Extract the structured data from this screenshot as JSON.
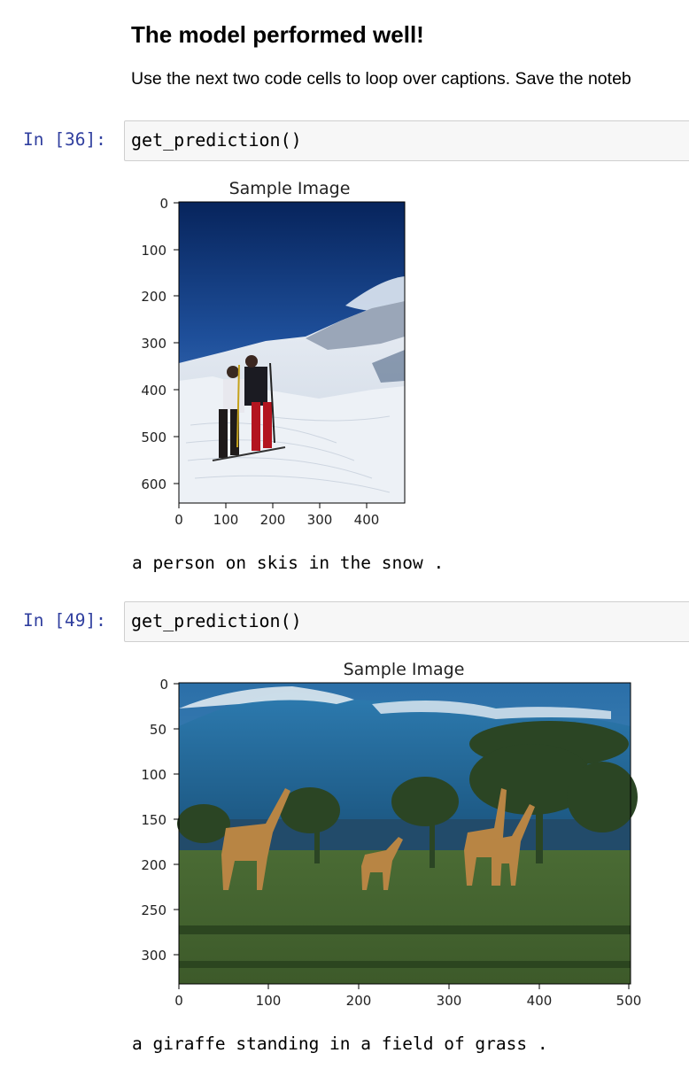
{
  "markdown": {
    "heading": "The model performed well!",
    "text": "Use the next two code cells to loop over captions. Save the noteb"
  },
  "cells": [
    {
      "prompt": "In [36]:",
      "code": "get_prediction()",
      "plot_title": "Sample Image",
      "y_ticks": [
        "0",
        "100",
        "200",
        "300",
        "400",
        "500",
        "600"
      ],
      "x_ticks": [
        "0",
        "100",
        "200",
        "300",
        "400"
      ],
      "image_description": "two people on skis on a snowy mountain slope",
      "caption": "a person on skis in the snow ."
    },
    {
      "prompt": "In [49]:",
      "code": "get_prediction()",
      "plot_title": "Sample Image",
      "y_ticks": [
        "0",
        "50",
        "100",
        "150",
        "200",
        "250",
        "300"
      ],
      "x_ticks": [
        "0",
        "100",
        "200",
        "300",
        "400",
        "500"
      ],
      "image_description": "giraffes walking in a grassy savanna with trees and a mountain",
      "caption": "a giraffe standing in a field of grass ."
    }
  ],
  "colors": {
    "prompt": "#303f9f",
    "code_bg": "#f7f7f7",
    "code_border": "#cfcfcf"
  }
}
